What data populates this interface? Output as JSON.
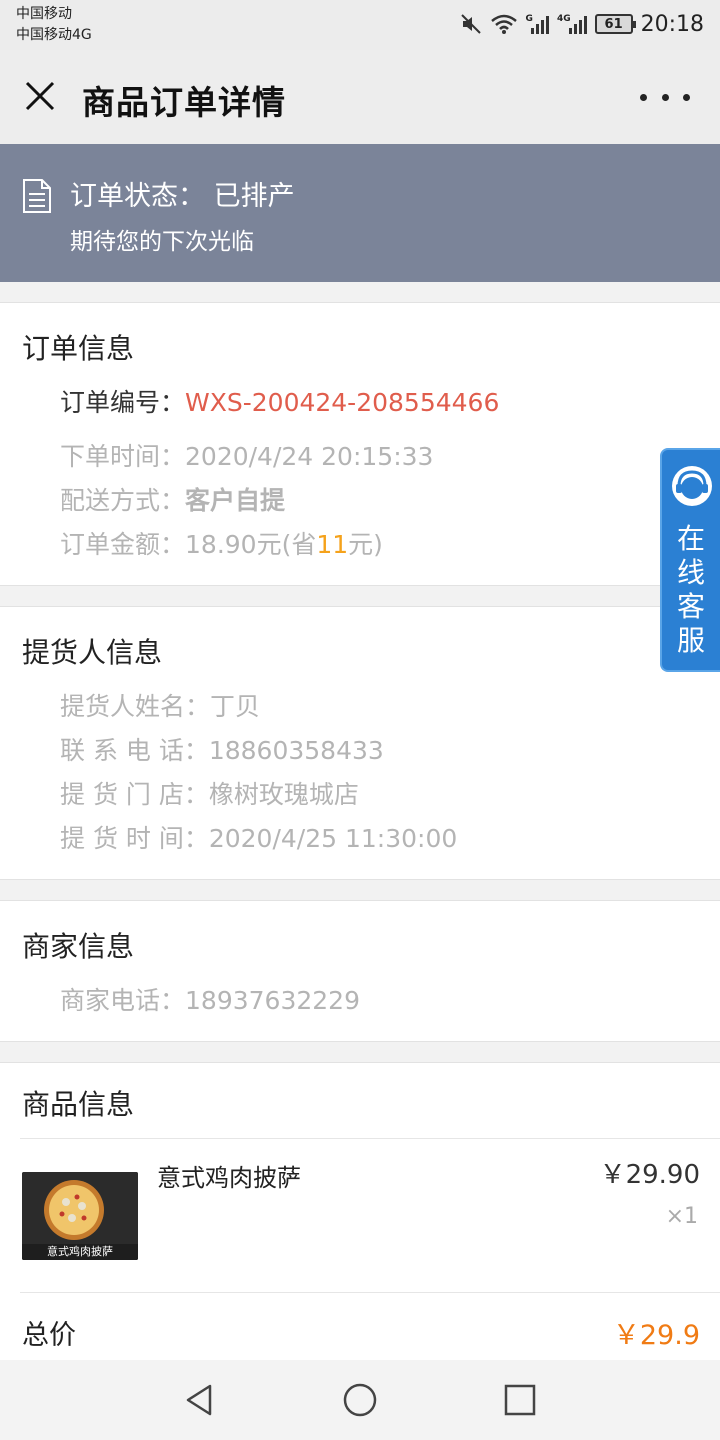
{
  "status_bar": {
    "carrier1": "中国移动",
    "carrier2": "中国移动4G",
    "sig1_tag": "G",
    "sig2_tag": "4G",
    "battery": "61",
    "time": "20:18"
  },
  "title_bar": {
    "title": "商品订单详情"
  },
  "banner": {
    "status": "订单状态：  已排产",
    "subtitle": "期待您的下次光临"
  },
  "order_info": {
    "title": "订单信息",
    "number_label": "订单编号：",
    "number": "WXS-200424-208554466",
    "time_label": "下单时间：",
    "time": "2020/4/24 20:15:33",
    "delivery_label": "配送方式：",
    "delivery": "客户自提",
    "amount_label": "订单金额：",
    "amount_prefix": "18.90元(省",
    "saved": "11",
    "amount_suffix": "元)"
  },
  "pickup_info": {
    "title": "提货人信息",
    "name_label": "提货人姓名：",
    "name": "丁贝",
    "phone_label": "联 系 电 话：",
    "phone": "18860358433",
    "store_label": "提 货 门 店：",
    "store": "橡树玫瑰城店",
    "time_label": "提 货 时 间：",
    "time": "2020/4/25 11:30:00"
  },
  "merchant_info": {
    "title": "商家信息",
    "phone_label": "商家电话：",
    "phone": "18937632229"
  },
  "product_info": {
    "title": "商品信息",
    "item_name": "意式鸡肉披萨",
    "item_price": "￥29.90",
    "item_qty": "×1",
    "thumb_caption": "意式鸡肉披萨",
    "total_label": "总价",
    "total": "￥29.9"
  },
  "service": {
    "label": "在线客服"
  },
  "colors": {
    "banner": "#7b8499",
    "order_number": "#e05d4c",
    "saved": "#f5a21b",
    "total": "#f07b14",
    "service": "#2b80d3"
  }
}
